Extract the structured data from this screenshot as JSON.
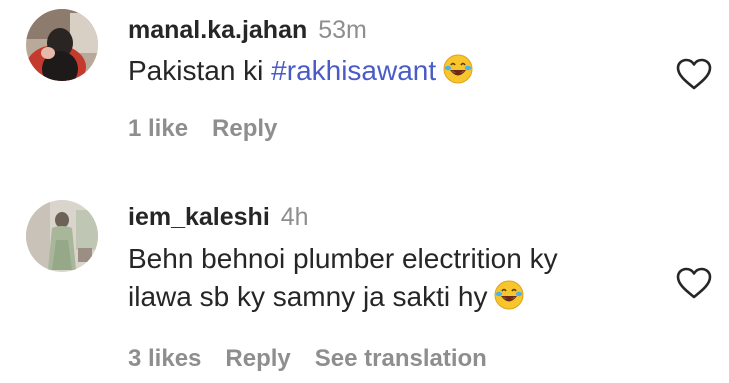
{
  "comments": [
    {
      "username": "manal.ka.jahan",
      "time": "53m",
      "text_before": "Pakistan ki ",
      "hashtag": "#rakhisawant",
      "emoji": "face-with-tears-of-joy",
      "likes": "1 like",
      "reply": "Reply",
      "liked": false
    },
    {
      "username": "iem_kaleshi",
      "time": "4h",
      "text_line1": "Behn behnoi plumber electrition ky",
      "text_line2": "ilawa sb ky samny ja sakti hy",
      "emoji": "face-with-tears-of-joy",
      "likes": "3 likes",
      "reply": "Reply",
      "translate": "See translation",
      "liked": false
    }
  ],
  "colors": {
    "text": "#262626",
    "muted": "#8e8e8e",
    "hashtag": "#4a5bc7",
    "background": "#ffffff"
  }
}
